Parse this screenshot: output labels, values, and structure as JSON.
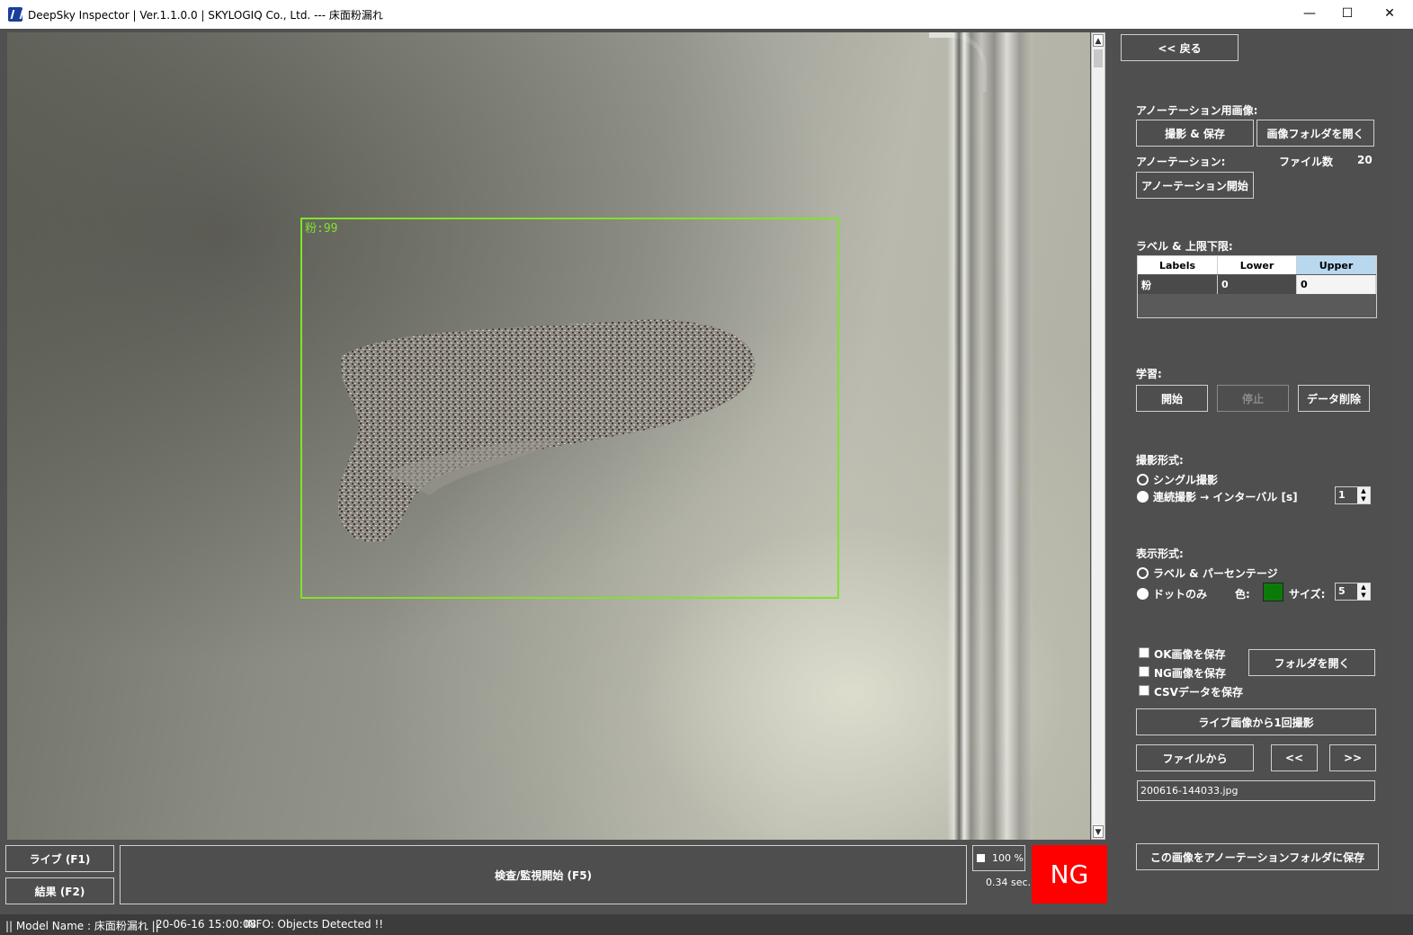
{
  "window": {
    "title": "DeepSky Inspector | Ver.1.1.0.0 | SKYLOGIQ Co., Ltd. --- 床面粉漏れ",
    "minimize": "—",
    "maximize": "☐",
    "close": "✕"
  },
  "viewer": {
    "detection_label": "粉:99",
    "detection_color": "#7fe32b"
  },
  "bottom": {
    "live_button": "ライブ (F1)",
    "result_button": "結果 (F2)",
    "inspect_button": "検査/監視開始 (F5)",
    "zoom": "100 %",
    "time": "0.34 sec.",
    "verdict": "NG",
    "verdict_color": "#ff0000"
  },
  "panel": {
    "back_button": "<< 戻る",
    "annotation_image_label": "アノーテーション用画像:",
    "capture_save_button": "撮影 & 保存",
    "open_image_folder_button": "画像フォルダを開く",
    "annotation_label": "アノーテーション:",
    "file_count_label": "ファイル数",
    "file_count_value": "20",
    "annotation_start_button": "アノーテーション開始",
    "label_limits_label": "ラベル & 上限下限:",
    "table": {
      "headers": [
        "Labels",
        "Lower",
        "Upper"
      ],
      "rows": [
        [
          "粉",
          "0",
          "0"
        ]
      ]
    },
    "learning_label": "学習:",
    "start_button": "開始",
    "stop_button": "停止",
    "delete_data_button": "データ削除",
    "capture_mode_label": "撮影形式:",
    "single_capture": "シングル撮影",
    "continuous_capture": "連続撮影 → インターバル [s]",
    "interval_value": "1",
    "display_mode_label": "表示形式:",
    "label_percentage": "ラベル & パーセンテージ",
    "dots_only": "ドットのみ",
    "color_label": "色:",
    "dot_color": "#0b7a0b",
    "size_label": "サイズ:",
    "size_value": "5",
    "save_ok": "OK画像を保存",
    "save_ng": "NG画像を保存",
    "save_csv": "CSVデータを保存",
    "open_folder_button": "フォルダを開く",
    "capture_once_button": "ライブ画像から1回撮影",
    "from_file_button": "ファイルから",
    "prev_button": "<<",
    "next_button": ">>",
    "filename": "200616-144033.jpg",
    "save_to_annotation_button": "この画像をアノーテーションフォルダに保存"
  },
  "status": {
    "model": "|| Model Name : 床面粉漏れ ||",
    "timestamp": "20-06-16 15:00:08",
    "info": "INFO:   Objects Detected !!"
  }
}
